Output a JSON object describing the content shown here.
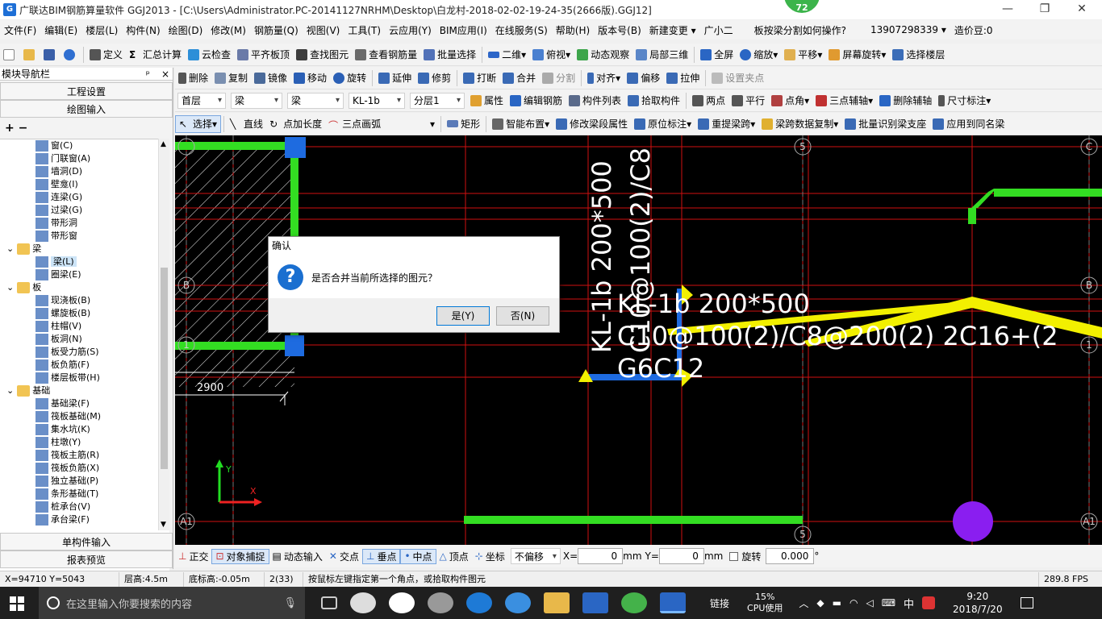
{
  "window": {
    "title": "广联达BIM钢筋算量软件 GGJ2013 - [C:\\Users\\Administrator.PC-20141127NRHM\\Desktop\\白龙村-2018-02-02-19-24-35(2666版).GGJ12]",
    "badge": "72",
    "controls": [
      "—",
      "❐",
      "✕"
    ]
  },
  "menu": [
    "文件(F)",
    "编辑(E)",
    "楼层(L)",
    "构件(N)",
    "绘图(D)",
    "修改(M)",
    "钢筋量(Q)",
    "视图(V)",
    "工具(T)",
    "云应用(Y)",
    "BIM应用(I)",
    "在线服务(S)",
    "帮助(H)",
    "版本号(B)",
    "新建变更 ▾",
    "广小二",
    "板按梁分割如何操作?",
    "13907298339 ▾",
    "造价豆:0"
  ],
  "toolbar1": [
    "定义",
    "汇总计算",
    "云检查",
    "平齐板顶",
    "查找图元",
    "查看钢筋量",
    "批量选择",
    "二维",
    "俯视",
    "动态观察",
    "局部三维",
    "全屏",
    "缩放",
    "平移",
    "屏幕旋转",
    "选择楼层"
  ],
  "toolbar2": [
    "删除",
    "复制",
    "镜像",
    "移动",
    "旋转",
    "延伸",
    "修剪",
    "打断",
    "合并",
    "分割",
    "对齐",
    "偏移",
    "拉伸",
    "设置夹点"
  ],
  "toolbar3": {
    "floor": "首层",
    "type1": "梁",
    "type2": "梁",
    "component": "KL-1b",
    "layer": "分层1",
    "items": [
      "属性",
      "编辑钢筋",
      "构件列表",
      "拾取构件",
      "两点",
      "平行",
      "点角",
      "三点辅轴",
      "删除辅轴",
      "尺寸标注"
    ]
  },
  "toolbar4": [
    "选择",
    "直线",
    "点加长度",
    "三点画弧",
    "矩形",
    "智能布置",
    "修改梁段属性",
    "原位标注",
    "重提梁跨",
    "梁跨数据复制",
    "批量识别梁支座",
    "应用到同名梁"
  ],
  "nav": {
    "title": "模块导航栏",
    "pin": "ᵖ",
    "close": "×",
    "btn_project": "工程设置",
    "btn_draw": "绘图输入",
    "expand_icons": "+ −",
    "tree": [
      {
        "label": "窗(C)",
        "level": 2,
        "group": false
      },
      {
        "label": "门联窗(A)",
        "level": 2,
        "group": false
      },
      {
        "label": "墙洞(D)",
        "level": 2,
        "group": false
      },
      {
        "label": "壁龛(I)",
        "level": 2,
        "group": false
      },
      {
        "label": "连梁(G)",
        "level": 2,
        "group": false
      },
      {
        "label": "过梁(G)",
        "level": 2,
        "group": false
      },
      {
        "label": "带形洞",
        "level": 2,
        "group": false
      },
      {
        "label": "带形窗",
        "level": 2,
        "group": false
      },
      {
        "label": "梁",
        "level": 1,
        "group": true
      },
      {
        "label": "梁(L)",
        "level": 2,
        "group": false,
        "selected": true
      },
      {
        "label": "圈梁(E)",
        "level": 2,
        "group": false
      },
      {
        "label": "板",
        "level": 1,
        "group": true
      },
      {
        "label": "现浇板(B)",
        "level": 2,
        "group": false
      },
      {
        "label": "螺旋板(B)",
        "level": 2,
        "group": false
      },
      {
        "label": "柱帽(V)",
        "level": 2,
        "group": false
      },
      {
        "label": "板洞(N)",
        "level": 2,
        "group": false
      },
      {
        "label": "板受力筋(S)",
        "level": 2,
        "group": false
      },
      {
        "label": "板负筋(F)",
        "level": 2,
        "group": false
      },
      {
        "label": "楼层板带(H)",
        "level": 2,
        "group": false
      },
      {
        "label": "基础",
        "level": 1,
        "group": true
      },
      {
        "label": "基础梁(F)",
        "level": 2,
        "group": false
      },
      {
        "label": "筏板基础(M)",
        "level": 2,
        "group": false
      },
      {
        "label": "集水坑(K)",
        "level": 2,
        "group": false
      },
      {
        "label": "柱墩(Y)",
        "level": 2,
        "group": false
      },
      {
        "label": "筏板主筋(R)",
        "level": 2,
        "group": false
      },
      {
        "label": "筏板负筋(X)",
        "level": 2,
        "group": false
      },
      {
        "label": "独立基础(P)",
        "level": 2,
        "group": false
      },
      {
        "label": "条形基础(T)",
        "level": 2,
        "group": false
      },
      {
        "label": "桩承台(V)",
        "level": 2,
        "group": false
      },
      {
        "label": "承台梁(F)",
        "level": 2,
        "group": false
      }
    ],
    "btn_single": "单构件输入",
    "btn_report": "报表预览"
  },
  "canvas": {
    "axis_labels": {
      "c": "C",
      "b": "B",
      "one": "1",
      "five": "5",
      "a1": "A1"
    },
    "dim_text": "2900",
    "beam_text_vertical": "KL-1b 200*500",
    "beam_text_vertical2": "C10@100(2)/C8",
    "beam_text_h1": "KL-1b 200*500",
    "beam_text_h2": "C10@100(2)/C8@200(2)  2C16+(2",
    "beam_text_h3": "G6C12",
    "axis_y": "Y",
    "axis_x": "X"
  },
  "dialog": {
    "title": "确认",
    "message": "是否合并当前所选择的图元？",
    "yes": "是(Y)",
    "no": "否(N)"
  },
  "snapbar": {
    "items": [
      "正交",
      "对象捕捉",
      "动态输入",
      "交点",
      "垂点",
      "中点",
      "顶点",
      "坐标"
    ],
    "offset": "不偏移",
    "x_label": "X=",
    "x_val": "0",
    "mm1": "mm",
    "y_label": "Y=",
    "y_val": "0",
    "mm2": "mm",
    "rotate": "旋转",
    "rot_val": "0.000",
    "deg": "°"
  },
  "status": {
    "coords": "X=94710 Y=5043",
    "floor_height": "层高:4.5m",
    "bottom_height": "底标高:-0.05m",
    "count": "2(33)",
    "hint": "按鼠标左键指定第一个角点，或拾取构件图元",
    "fps": "289.8 FPS"
  },
  "taskbar": {
    "search_placeholder": "在这里输入你要搜索的内容",
    "link": "链接",
    "cpu_pct": "15%",
    "cpu_label": "CPU使用",
    "ime": "中",
    "time": "9:20",
    "date": "2018/7/20"
  }
}
